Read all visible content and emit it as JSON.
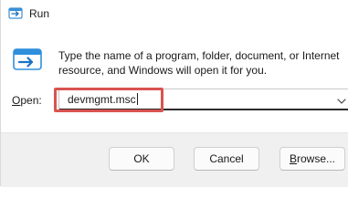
{
  "window": {
    "title": "Run",
    "icon": "run-app-icon"
  },
  "dialog": {
    "icon": "run-dialog-icon",
    "description_line1": "Type the name of a program, folder, document, or Internet",
    "description_line2": "resource, and Windows will open it for you."
  },
  "open_field": {
    "label_accel": "O",
    "label_rest": "pen:",
    "value": "devmgmt.msc",
    "dropdown_icon": "chevron-down-icon"
  },
  "highlight": {
    "color": "#d9534f"
  },
  "buttons": {
    "ok_label": "OK",
    "cancel_label": "Cancel",
    "browse_accel": "B",
    "browse_rest": "rowse..."
  },
  "colors": {
    "accent": "#0067c0",
    "footer_bg": "#f0f0f0"
  }
}
